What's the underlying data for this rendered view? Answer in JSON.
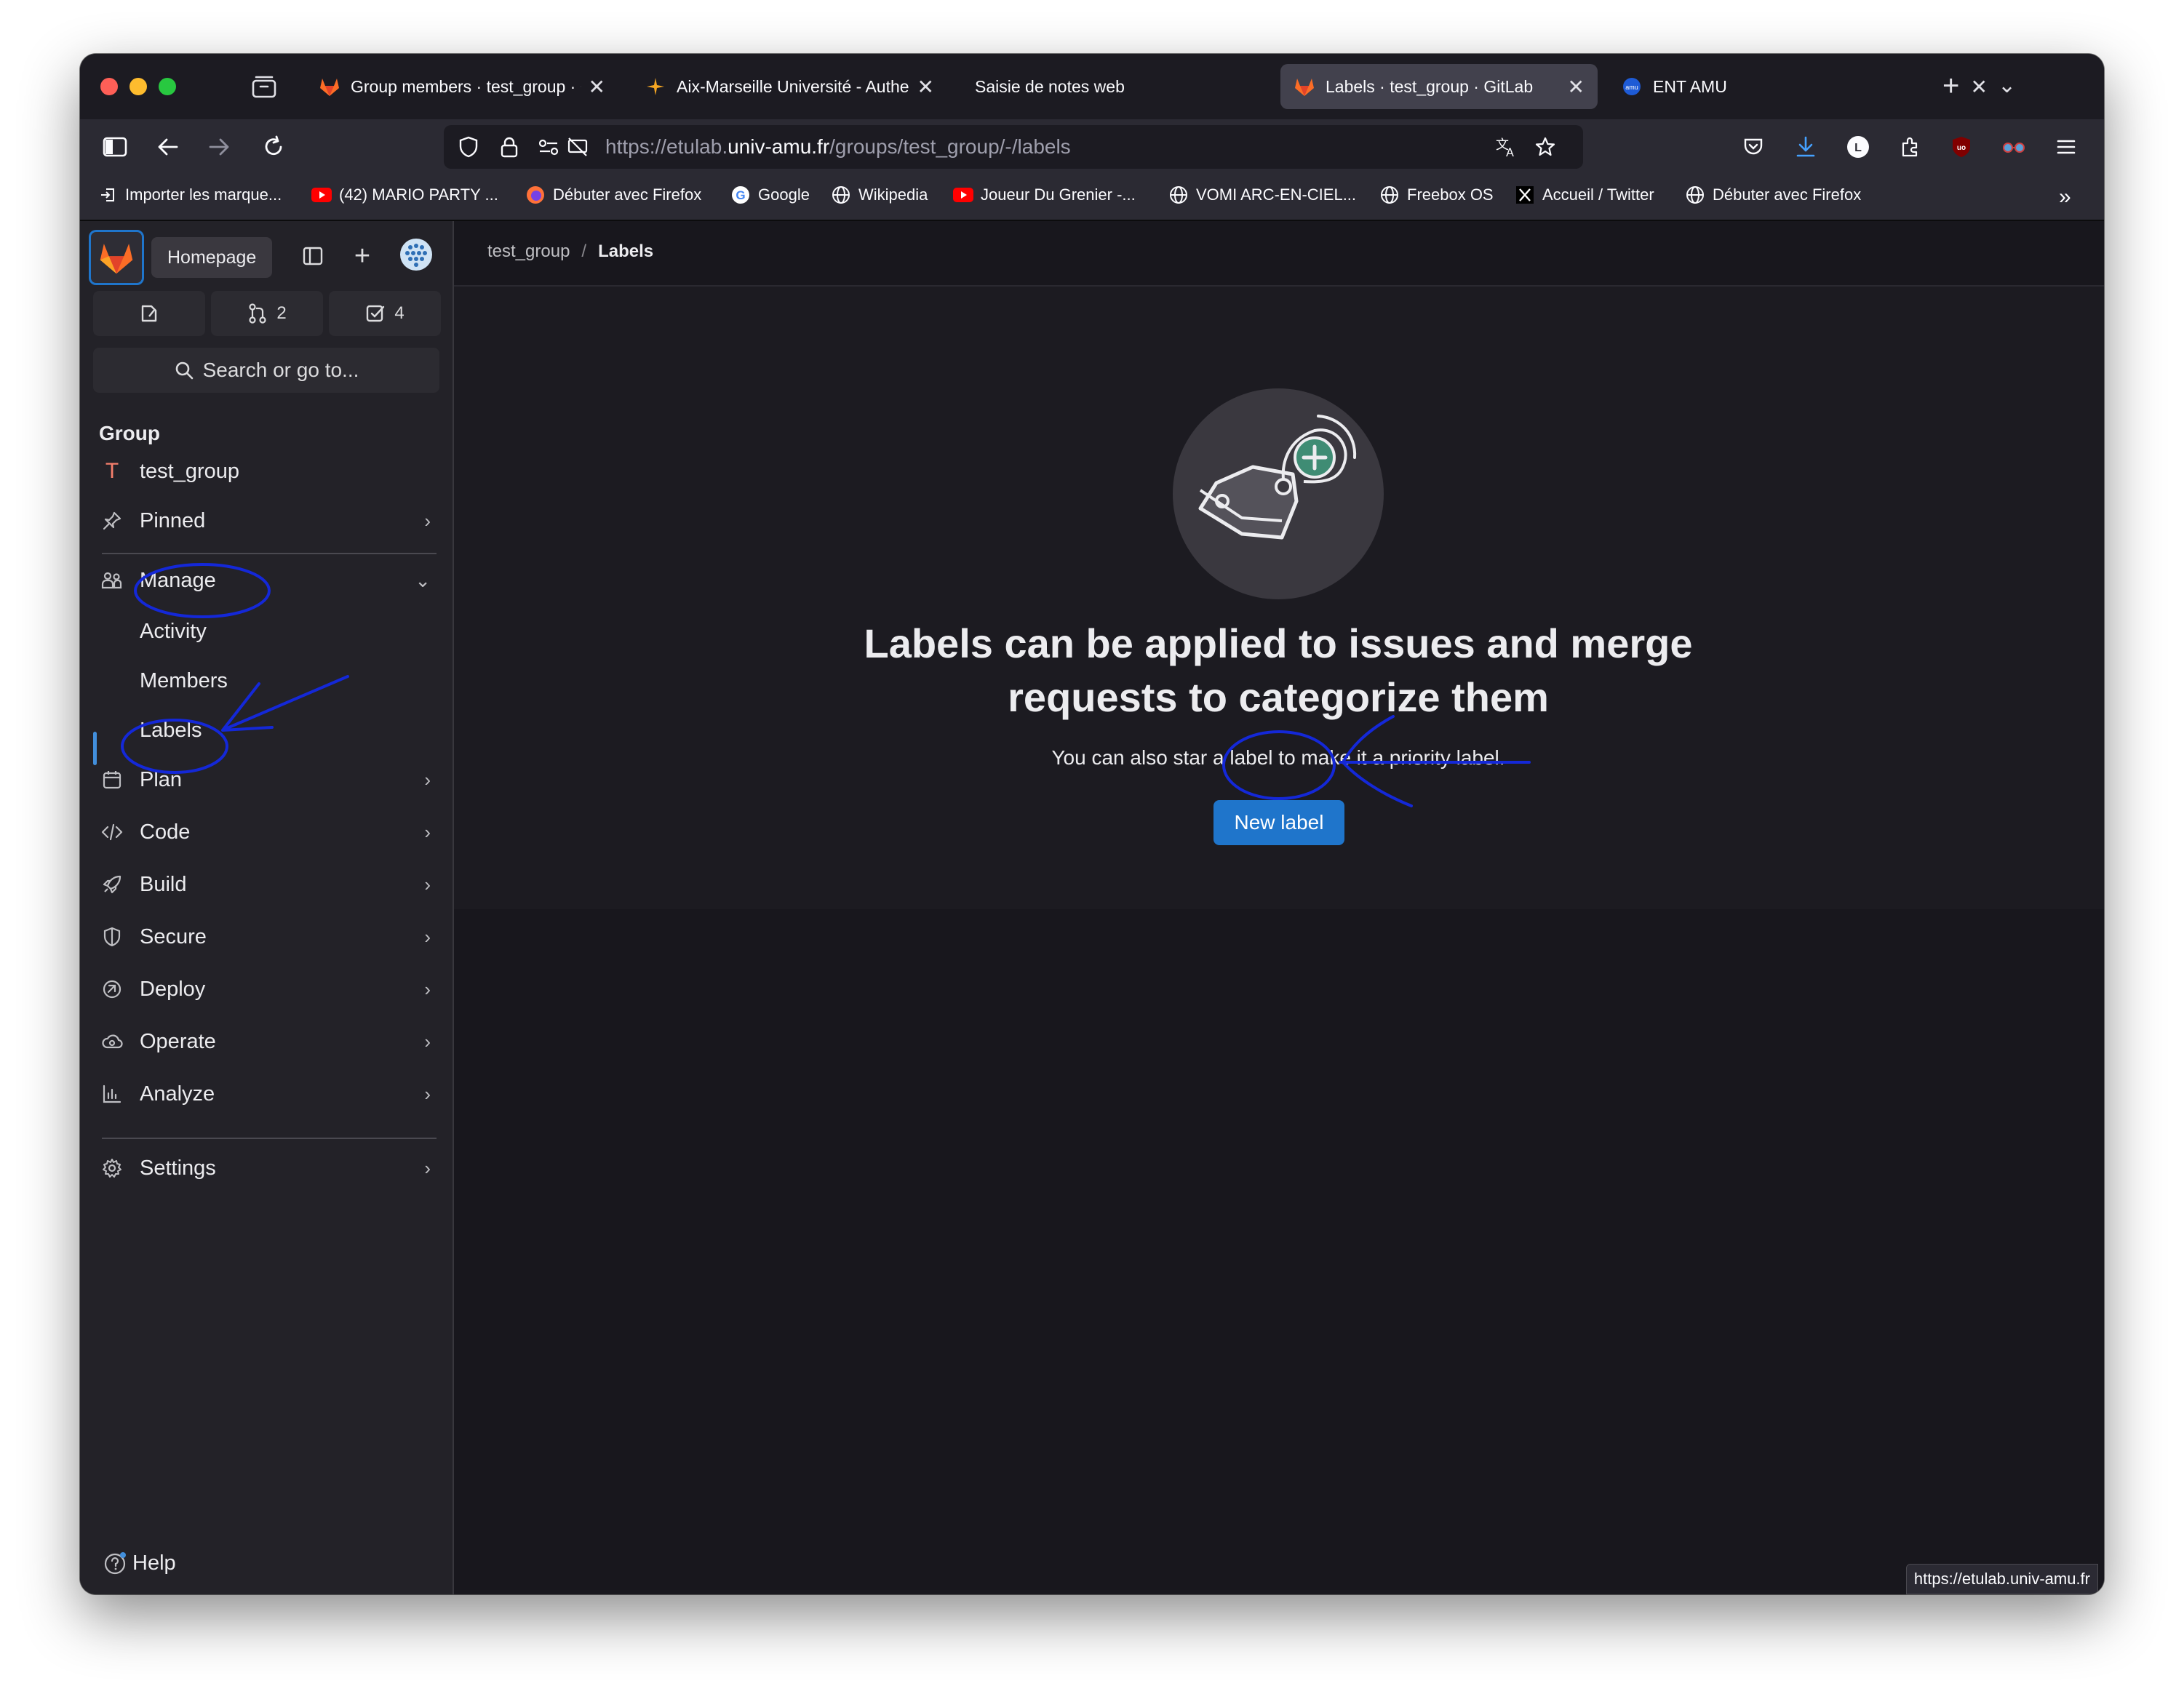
{
  "browser": {
    "tabs": [
      {
        "title": "Group members · test_group · G",
        "favicon": "gitlab-fox-icon",
        "active": false
      },
      {
        "title": "Aix-Marseille Université - Authe",
        "favicon": "amu-star-icon",
        "active": false
      },
      {
        "title": "Saisie de notes web",
        "favicon": "",
        "active": false
      },
      {
        "title": "Labels · test_group · GitLab",
        "favicon": "gitlab-fox-icon",
        "active": true
      },
      {
        "title": "ENT AMU",
        "favicon": "amu-circle-icon",
        "active": false
      }
    ],
    "url_prefix": "https://etulab.",
    "url_domain": "univ-amu.fr",
    "url_path": "/groups/test_group/-/labels",
    "bookmarks": [
      {
        "label": "Importer les marque...",
        "icon": "import-icon"
      },
      {
        "label": "(42) MARIO PARTY ...",
        "icon": "youtube-icon"
      },
      {
        "label": "Débuter avec Firefox",
        "icon": "firefox-icon"
      },
      {
        "label": "Google",
        "icon": "google-icon"
      },
      {
        "label": "Wikipedia",
        "icon": "globe-icon"
      },
      {
        "label": "Joueur Du Grenier -...",
        "icon": "youtube-icon"
      },
      {
        "label": "VOMI ARC-EN-CIEL...",
        "icon": "globe-icon"
      },
      {
        "label": "Freebox OS",
        "icon": "globe-icon"
      },
      {
        "label": "Accueil / Twitter",
        "icon": "x-icon"
      },
      {
        "label": "Débuter avec Firefox",
        "icon": "globe-icon"
      }
    ],
    "status_url": "https://etulab.univ-amu.fr"
  },
  "sidebar": {
    "homepage_tooltip": "Homepage",
    "merge_requests_count": "2",
    "todos_count": "4",
    "search_label": "Search or go to...",
    "group_heading": "Group",
    "group_initial": "T",
    "group_name": "test_group",
    "items": {
      "pinned": "Pinned",
      "manage": "Manage",
      "activity": "Activity",
      "members": "Members",
      "labels": "Labels",
      "plan": "Plan",
      "code": "Code",
      "build": "Build",
      "secure": "Secure",
      "deploy": "Deploy",
      "operate": "Operate",
      "analyze": "Analyze",
      "settings": "Settings"
    },
    "help": "Help"
  },
  "breadcrumb": {
    "group": "test_group",
    "separator": "/",
    "current": "Labels"
  },
  "empty_state": {
    "title_line1": "Labels can be applied to issues and merge",
    "title_line2": "requests to categorize them",
    "description": "You can also star a label to make it a priority label.",
    "button": "New label"
  },
  "colors": {
    "accent": "#1f75cb",
    "annotation": "#1428d8",
    "sidebar_bg": "#232228",
    "main_bg": "#18171d"
  }
}
